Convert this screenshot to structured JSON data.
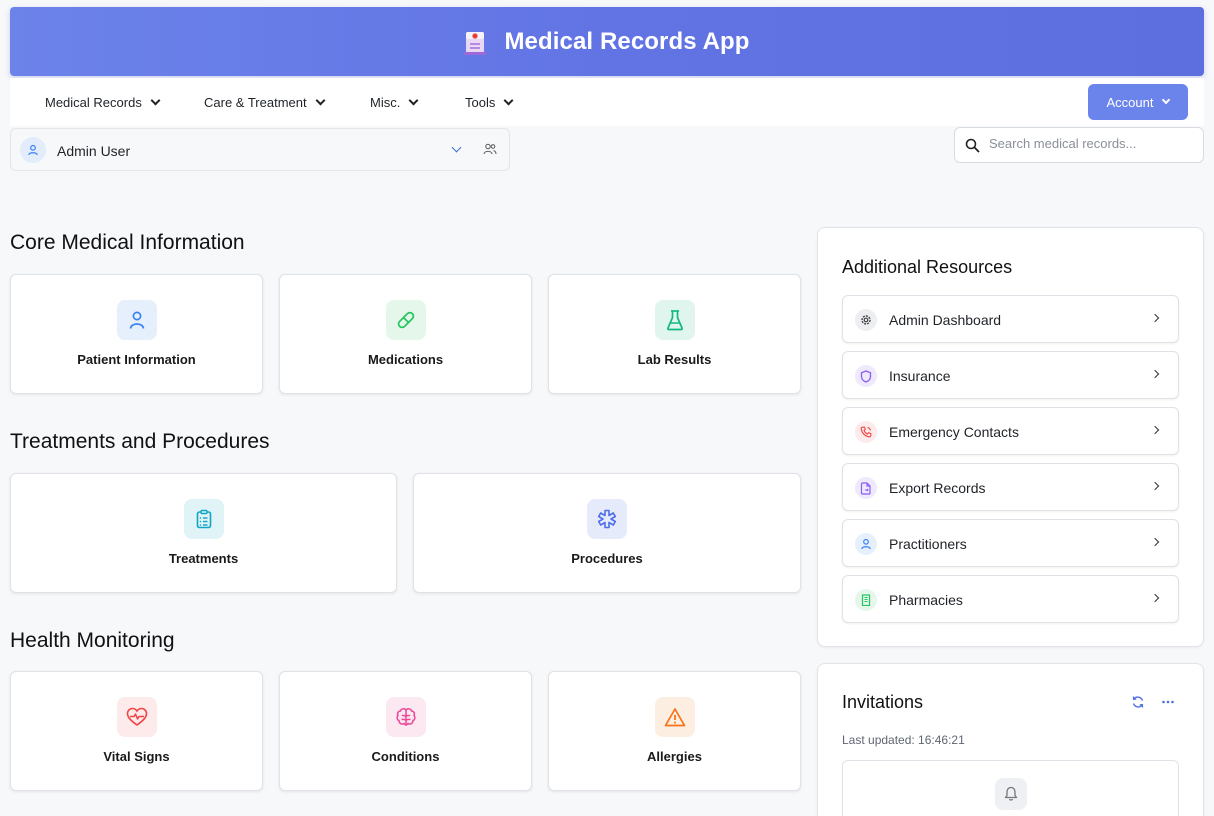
{
  "header": {
    "title": "Medical Records App",
    "logo_icon": "hospital-icon"
  },
  "nav": {
    "items": [
      {
        "label": "Medical Records"
      },
      {
        "label": "Care & Treatment"
      },
      {
        "label": "Misc."
      },
      {
        "label": "Tools"
      }
    ],
    "account_label": "Account"
  },
  "user": {
    "name": "Admin User"
  },
  "search": {
    "placeholder": "Search medical records..."
  },
  "sections": {
    "core": {
      "title": "Core Medical Information",
      "cards": [
        {
          "label": "Patient Information",
          "icon": "person-icon",
          "color": "#3b82f6",
          "bg": "#e6f0fd"
        },
        {
          "label": "Medications",
          "icon": "pill-icon",
          "color": "#22c55e",
          "bg": "#e4f7ea"
        },
        {
          "label": "Lab Results",
          "icon": "flask-icon",
          "color": "#10b981",
          "bg": "#e0f5ee"
        }
      ]
    },
    "treatments": {
      "title": "Treatments and Procedures",
      "cards": [
        {
          "label": "Treatments",
          "icon": "clipboard-icon",
          "color": "#0ea5c6",
          "bg": "#e0f4f8"
        },
        {
          "label": "Procedures",
          "icon": "medical-cross-icon",
          "color": "#4f6fe8",
          "bg": "#e6ebfc"
        }
      ]
    },
    "monitoring": {
      "title": "Health Monitoring",
      "cards": [
        {
          "label": "Vital Signs",
          "icon": "heart-pulse-icon",
          "color": "#ef4444",
          "bg": "#fdeaea"
        },
        {
          "label": "Conditions",
          "icon": "brain-icon",
          "color": "#ec4899",
          "bg": "#fce8f1"
        },
        {
          "label": "Allergies",
          "icon": "warning-icon",
          "color": "#f97316",
          "bg": "#fdeee2"
        }
      ]
    }
  },
  "resources": {
    "title": "Additional Resources",
    "items": [
      {
        "label": "Admin Dashboard",
        "icon": "gear-icon",
        "color": "#555",
        "bg": "#eceef1"
      },
      {
        "label": "Insurance",
        "icon": "shield-icon",
        "color": "#8b5cf6",
        "bg": "#efe9fd"
      },
      {
        "label": "Emergency Contacts",
        "icon": "phone-icon",
        "color": "#ef4444",
        "bg": "#fdeaea"
      },
      {
        "label": "Export Records",
        "icon": "file-export-icon",
        "color": "#8b5cf6",
        "bg": "#efe9fd"
      },
      {
        "label": "Practitioners",
        "icon": "person-icon",
        "color": "#3b82f6",
        "bg": "#e6f0fd"
      },
      {
        "label": "Pharmacies",
        "icon": "building-icon",
        "color": "#22c55e",
        "bg": "#e4f7ea"
      }
    ]
  },
  "invitations": {
    "title": "Invitations",
    "last_updated": "Last updated: 16:46:21"
  }
}
